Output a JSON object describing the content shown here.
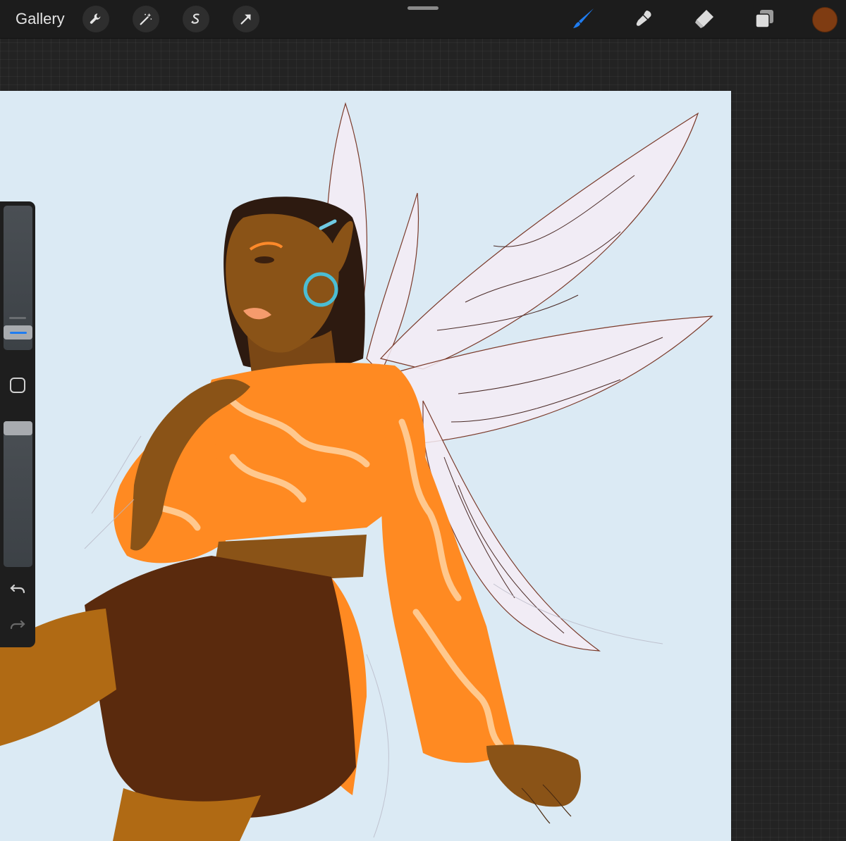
{
  "app": {
    "gallery_label": "Gallery"
  },
  "toolbar": {
    "left_tools": [
      "wrench-icon",
      "magic-wand-icon",
      "selection-icon",
      "transform-arrow-icon"
    ],
    "right_tools": [
      "brush-icon",
      "smudge-icon",
      "eraser-icon",
      "layers-icon"
    ],
    "active_tool": "brush-icon",
    "active_color": "#7f3c12",
    "accent_color": "#1f7cf0"
  },
  "sidebar": {
    "brush_size_level": 0.72,
    "opacity_level": 1.0,
    "controls": [
      "modify-button-icon",
      "undo-icon",
      "redo-icon"
    ]
  },
  "canvas": {
    "background_color": "#dbeaf4",
    "subject": "fairy-illustration"
  }
}
